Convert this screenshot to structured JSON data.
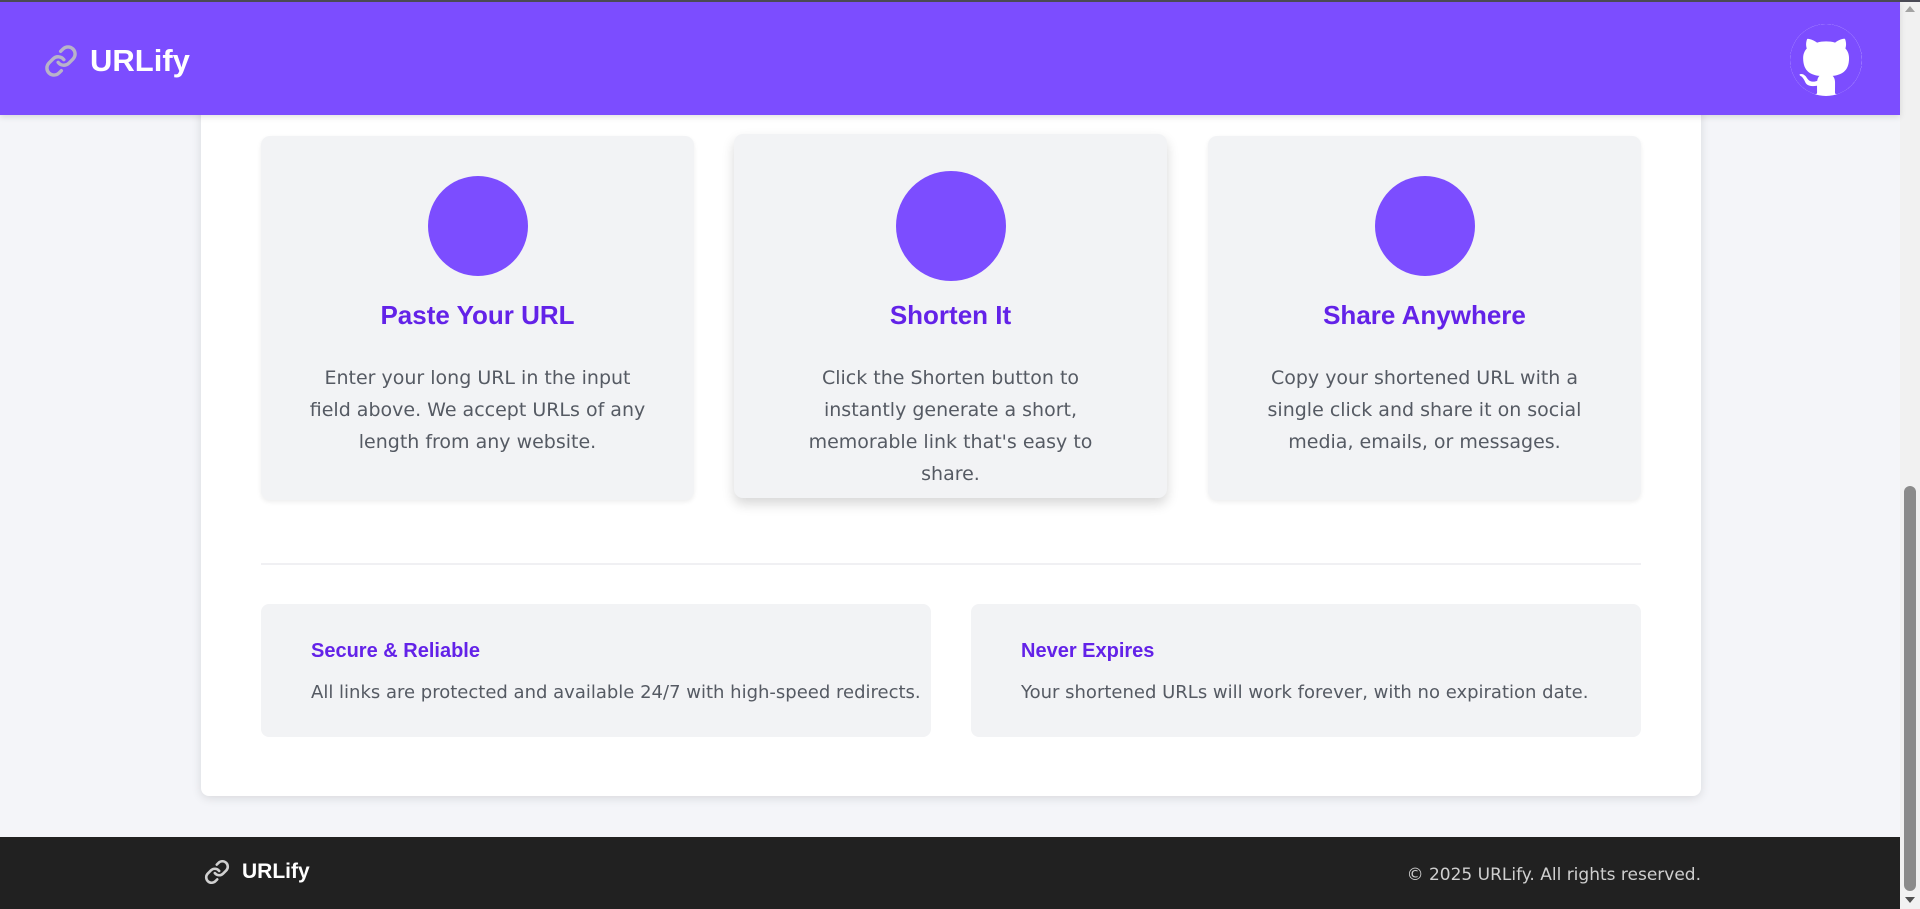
{
  "app": {
    "name": "URLify",
    "logo_icon": "link-icon",
    "github_icon": "github-icon"
  },
  "steps": [
    {
      "title": "Paste Your URL",
      "description": "Enter your long URL in the input field above. We accept URLs of any length from any website."
    },
    {
      "title": "Shorten It",
      "description": "Click the Shorten button to instantly generate a short, memorable link that's easy to share."
    },
    {
      "title": "Share Anywhere",
      "description": "Copy your shortened URL with a single click and share it on social media, emails, or messages."
    }
  ],
  "features": [
    {
      "title": "Secure & Reliable",
      "description": "All links are protected and available 24/7 with high-speed redirects."
    },
    {
      "title": "Never Expires",
      "description": "Your shortened URLs will work forever, with no expiration date."
    }
  ],
  "footer": {
    "brand": "URLify",
    "copyright": "© 2025 URLify. All rights reserved."
  },
  "colors": {
    "accent": "#7c4dff",
    "heading": "#6322e8",
    "footer_bg": "#212121"
  }
}
